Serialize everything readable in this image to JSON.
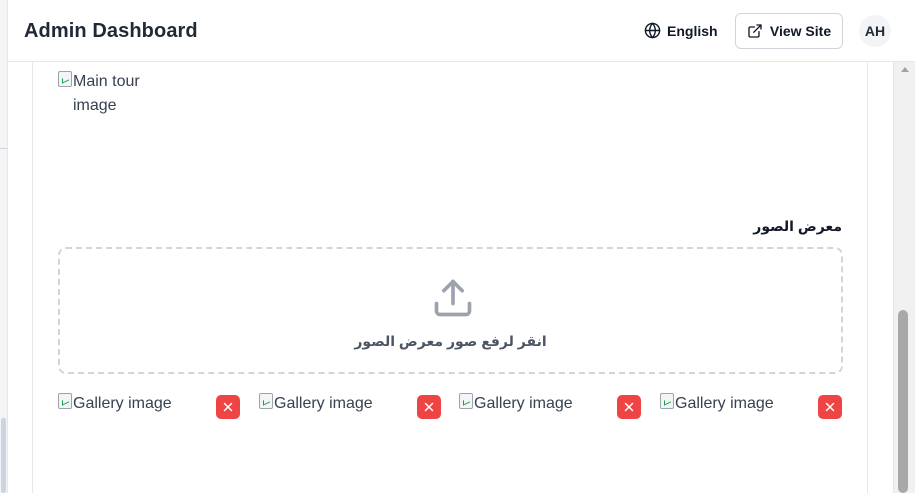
{
  "header": {
    "title": "Admin Dashboard",
    "language_label": "English",
    "view_site_label": "View Site",
    "avatar_initials": "AH"
  },
  "main_image": {
    "alt": "Main tour image"
  },
  "gallery": {
    "label": "معرض الصور",
    "upload_text": "انقر لرفع صور معرض الصور",
    "items": [
      {
        "alt": "Gallery image"
      },
      {
        "alt": "Gallery image"
      },
      {
        "alt": "Gallery image"
      },
      {
        "alt": "Gallery image"
      }
    ]
  },
  "colors": {
    "remove_button": "#ef4444",
    "upload_icon": "#9ca3af",
    "dropzone_border": "#d1d5db"
  },
  "icons": {
    "language": "globe-icon",
    "view_site": "external-link-icon",
    "upload": "upload-icon",
    "remove": "close-icon"
  }
}
